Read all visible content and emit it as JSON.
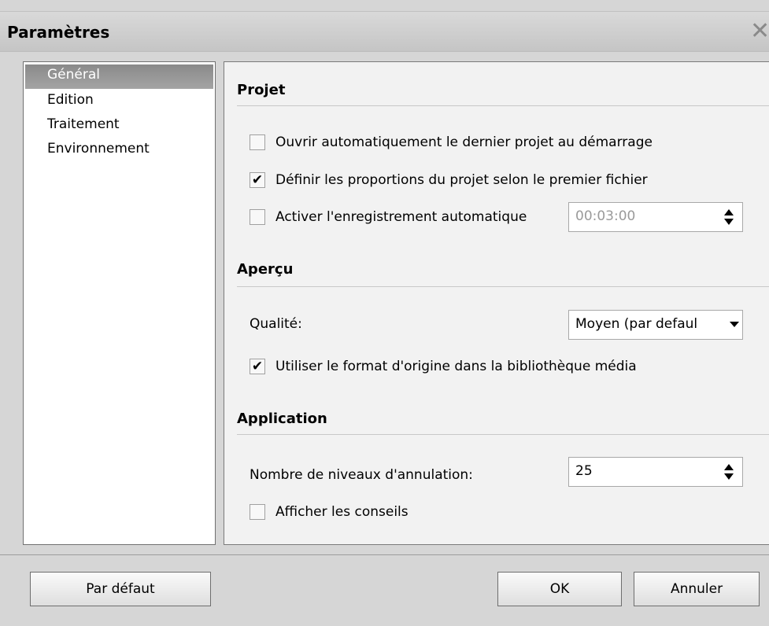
{
  "window": {
    "title": "Paramètres",
    "close_glyph": "✕"
  },
  "sidebar": {
    "items": [
      {
        "label": "Général",
        "active": true
      },
      {
        "label": "Edition"
      },
      {
        "label": "Traitement"
      },
      {
        "label": "Environnement"
      }
    ]
  },
  "projet": {
    "title": "Projet",
    "open_last": {
      "label": "Ouvrir automatiquement le dernier projet au démarrage",
      "checked": false
    },
    "proportions": {
      "label": "Définir les proportions du projet selon le premier fichier",
      "checked": true
    },
    "autosave": {
      "label": "Activer l'enregistrement automatique",
      "checked": false,
      "value": "00:03:00"
    }
  },
  "apercu": {
    "title": "Aperçu",
    "quality_label": "Qualité:",
    "quality_value": "Moyen (par defaul",
    "original_format": {
      "label": "Utiliser le format d'origine dans la bibliothèque média",
      "checked": true
    }
  },
  "application": {
    "title": "Application",
    "undo_label": "Nombre de niveaux d'annulation:",
    "undo_value": "25",
    "show_tips": {
      "label": "Afficher les conseils",
      "checked": false
    }
  },
  "buttons": {
    "default": "Par défaut",
    "ok": "OK",
    "cancel": "Annuler"
  },
  "icons": {
    "check": "check-icon",
    "spin": "spin-arrows-icon",
    "dropdown": "chevron-down-icon",
    "close": "close-icon"
  }
}
